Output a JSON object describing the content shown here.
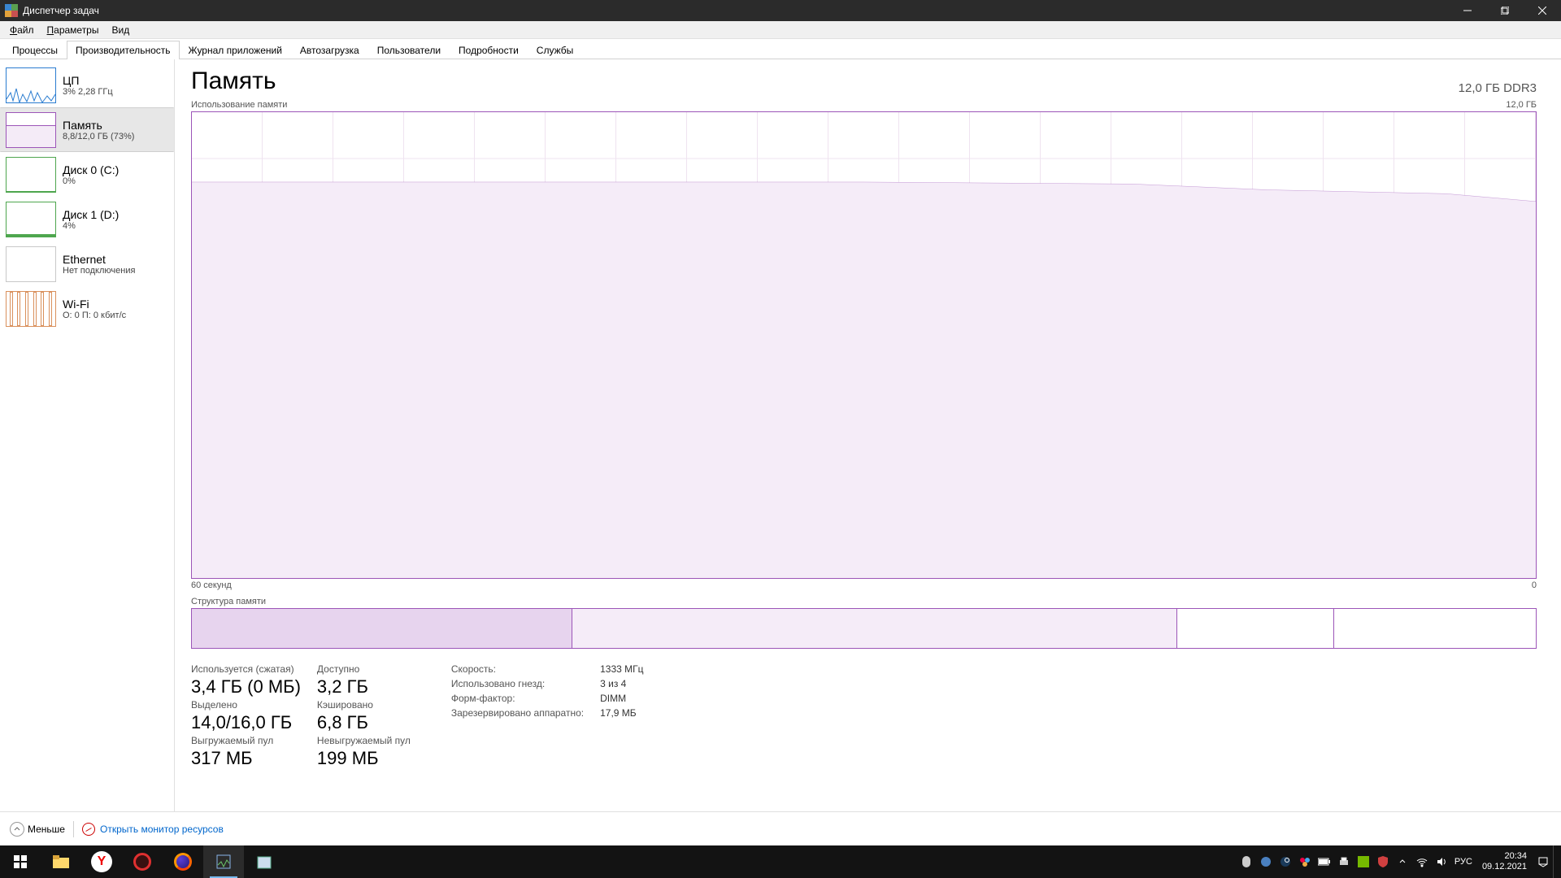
{
  "window": {
    "title": "Диспетчер задач"
  },
  "menu": {
    "file": "Файл",
    "options": "Параметры",
    "view": "Вид"
  },
  "tabs": {
    "processes": "Процессы",
    "performance": "Производительность",
    "appHistory": "Журнал приложений",
    "startup": "Автозагрузка",
    "users": "Пользователи",
    "details": "Подробности",
    "services": "Службы"
  },
  "sidebar": {
    "cpu": {
      "name": "ЦП",
      "sub": "3% 2,28 ГГц"
    },
    "mem": {
      "name": "Память",
      "sub": "8,8/12,0 ГБ (73%)"
    },
    "disk0": {
      "name": "Диск 0 (C:)",
      "sub": "0%"
    },
    "disk1": {
      "name": "Диск 1 (D:)",
      "sub": "4%"
    },
    "eth": {
      "name": "Ethernet",
      "sub": "Нет подключения"
    },
    "wifi": {
      "name": "Wi-Fi",
      "sub": "О: 0 П: 0 кбит/с"
    }
  },
  "content": {
    "title": "Память",
    "totalLabel": "12,0 ГБ DDR3",
    "usageLabel": "Использование памяти",
    "usageMax": "12,0 ГБ",
    "timeRange": "60 секунд",
    "timeRangeEnd": "0",
    "structureLabel": "Структура памяти"
  },
  "stats": {
    "inUseLabel": "Используется (сжатая)",
    "inUseValue": "3,4 ГБ (0 МБ)",
    "availLabel": "Доступно",
    "availValue": "3,2 ГБ",
    "committedLabel": "Выделено",
    "committedValue": "14,0/16,0 ГБ",
    "cachedLabel": "Кэшировано",
    "cachedValue": "6,8 ГБ",
    "pagedLabel": "Выгружаемый пул",
    "pagedValue": "317 МБ",
    "nonpagedLabel": "Невыгружаемый пул",
    "nonpagedValue": "199 МБ"
  },
  "info": {
    "speedLabel": "Скорость:",
    "speedValue": "1333 МГц",
    "slotsLabel": "Использовано гнезд:",
    "slotsValue": "3 из 4",
    "formLabel": "Форм-фактор:",
    "formValue": "DIMM",
    "reservedLabel": "Зарезервировано аппаратно:",
    "reservedValue": "17,9 МБ"
  },
  "bottom": {
    "lessLabel": "Меньше",
    "resmonLabel": "Открыть монитор ресурсов"
  },
  "taskbar": {
    "lang": "РУС",
    "time": "20:34",
    "date": "09.12.2021"
  },
  "chart_data": {
    "type": "area",
    "title": "Использование памяти",
    "ylabel": "ГБ",
    "ylim": [
      0,
      12.0
    ],
    "xlabel": "секунд",
    "xlim": [
      60,
      0
    ],
    "series": [
      {
        "name": "Используется",
        "x": [
          60,
          30,
          18,
          12,
          4,
          0
        ],
        "y": [
          10.2,
          10.2,
          10.15,
          10.0,
          9.9,
          9.7
        ]
      }
    ],
    "composition": {
      "segments": [
        {
          "name": "in_use",
          "value_gb": 3.4
        },
        {
          "name": "modified",
          "value_gb": 5.4
        },
        {
          "name": "standby",
          "value_gb": 1.4
        },
        {
          "name": "free",
          "value_gb": 1.8
        }
      ],
      "total_gb": 12.0
    }
  }
}
